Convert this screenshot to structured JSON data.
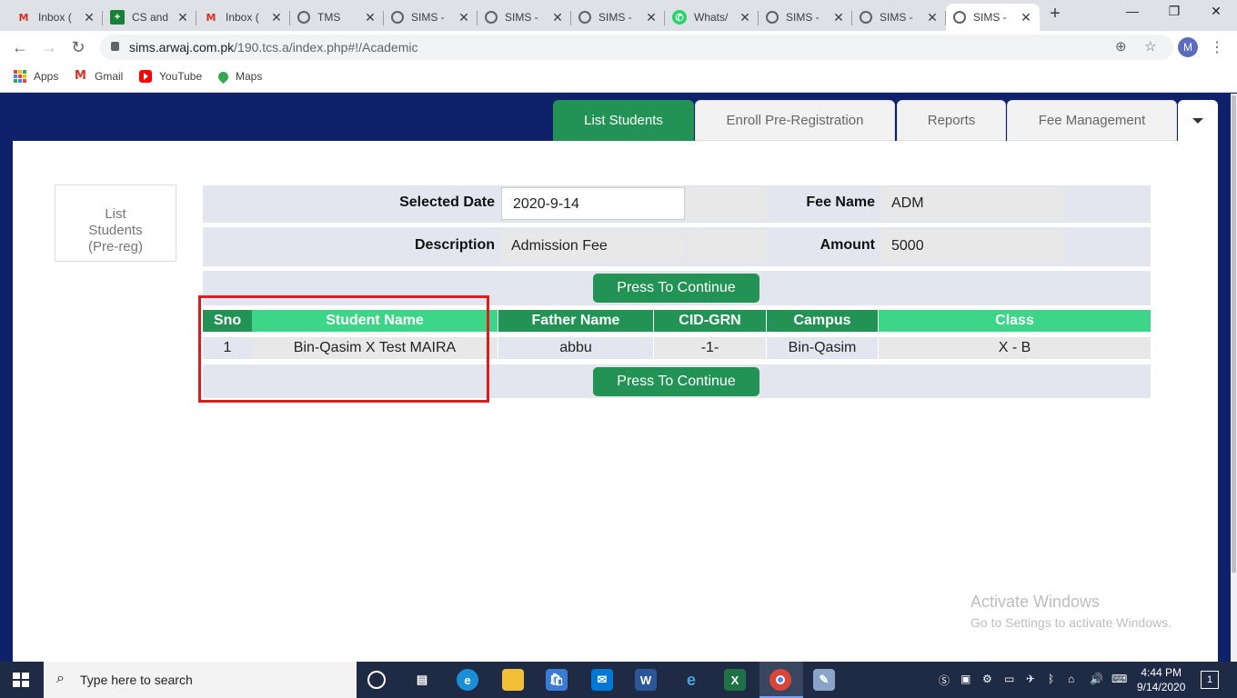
{
  "browser": {
    "tabs": [
      {
        "title": "Inbox (",
        "icon": "gmail-icon",
        "glyph": "M"
      },
      {
        "title": "CS and",
        "icon": "sheets-icon",
        "glyph": "+"
      },
      {
        "title": "Inbox (",
        "icon": "gmail-icon",
        "glyph": "M"
      },
      {
        "title": "TMS",
        "icon": "globe-icon",
        "glyph": ""
      },
      {
        "title": "SIMS -",
        "icon": "globe-icon",
        "glyph": ""
      },
      {
        "title": "SIMS -",
        "icon": "globe-icon",
        "glyph": ""
      },
      {
        "title": "SIMS -",
        "icon": "globe-icon",
        "glyph": ""
      },
      {
        "title": "Whats/",
        "icon": "whatsapp-icon",
        "glyph": "✆"
      },
      {
        "title": "SIMS -",
        "icon": "globe-icon",
        "glyph": ""
      },
      {
        "title": "SIMS -",
        "icon": "globe-icon",
        "glyph": ""
      },
      {
        "title": "SIMS -",
        "icon": "globe-icon",
        "glyph": "",
        "active": true
      }
    ],
    "url_domain": "sims.arwaj.com.pk",
    "url_path": "/190.tcs.a/index.php#!/Academic",
    "profile_initial": "M",
    "bookmarks": [
      "Apps",
      "Gmail",
      "YouTube",
      "Maps"
    ]
  },
  "nav": {
    "tabs": [
      "List Students",
      "Enroll Pre-Registration",
      "Reports",
      "Fee Management"
    ],
    "active_tab": "List Students"
  },
  "sidebar": {
    "line1": "List",
    "line2": "Students",
    "line3": "(Pre-reg)"
  },
  "form": {
    "selected_date_label": "Selected Date",
    "selected_date_value": "2020-9-14",
    "fee_name_label": "Fee Name",
    "fee_name_value": "ADM",
    "description_label": "Description",
    "description_value": "Admission Fee",
    "amount_label": "Amount",
    "amount_value": "5000",
    "continue_label": "Press To Continue"
  },
  "table": {
    "headers": [
      "Sno",
      "Student Name",
      "Father Name",
      "CID-GRN",
      "Campus",
      "Class"
    ],
    "rows": [
      [
        "1",
        "Bin-Qasim X Test MAIRA",
        "abbu",
        "-1-",
        "Bin-Qasim",
        "X - B"
      ]
    ]
  },
  "watermark": {
    "line1": "Activate Windows",
    "line2": "Go to Settings to activate Windows."
  },
  "taskbar": {
    "search_placeholder": "Type here to search",
    "time": "4:44 PM",
    "date": "9/14/2020",
    "notification_count": "1"
  },
  "colors": {
    "brand_green": "#229355",
    "header_light_green": "#3dd688",
    "page_navy": "#10216b",
    "highlight_red": "#e01b1b"
  }
}
